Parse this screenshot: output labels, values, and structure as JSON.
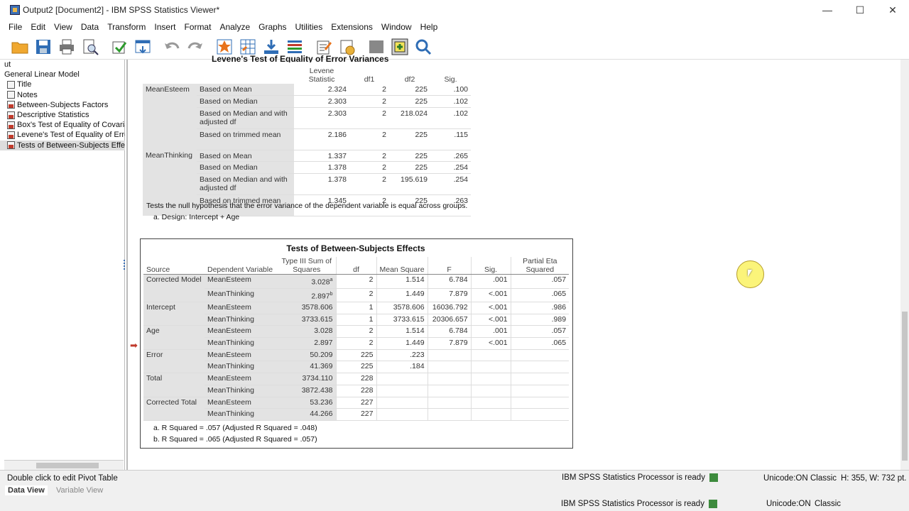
{
  "window": {
    "title": "Output2 [Document2] - IBM SPSS Statistics Viewer*",
    "minimize": "—",
    "maximize": "☐",
    "close": "✕"
  },
  "menu": [
    "File",
    "Edit",
    "View",
    "Data",
    "Transform",
    "Insert",
    "Format",
    "Analyze",
    "Graphs",
    "Utilities",
    "Extensions",
    "Window",
    "Help"
  ],
  "outline": {
    "root_prefix": "ut",
    "root": "General Linear Model",
    "items": [
      "Title",
      "Notes",
      "Between-Subjects Factors",
      "Descriptive Statistics",
      "Box's Test of Equality of Covariar",
      "Levene's Test of Equality of Error",
      "Tests of Between-Subjects Effec"
    ],
    "selected_index": 6
  },
  "levene": {
    "title": "Levene's Test of Equality of Error Variances",
    "headers": [
      "Levene Statistic",
      "df1",
      "df2",
      "Sig."
    ],
    "groups": [
      {
        "name": "MeanEsteem",
        "rows": [
          {
            "label": "Based on Mean",
            "stat": "2.324",
            "df1": "2",
            "df2": "225",
            "sig": ".100"
          },
          {
            "label": "Based on Median",
            "stat": "2.303",
            "df1": "2",
            "df2": "225",
            "sig": ".102"
          },
          {
            "label": "Based on Median and with adjusted df",
            "stat": "2.303",
            "df1": "2",
            "df2": "218.024",
            "sig": ".102"
          },
          {
            "label": "Based on trimmed mean",
            "stat": "2.186",
            "df1": "2",
            "df2": "225",
            "sig": ".115"
          }
        ]
      },
      {
        "name": "MeanThinking",
        "rows": [
          {
            "label": "Based on Mean",
            "stat": "1.337",
            "df1": "2",
            "df2": "225",
            "sig": ".265"
          },
          {
            "label": "Based on Median",
            "stat": "1.378",
            "df1": "2",
            "df2": "225",
            "sig": ".254"
          },
          {
            "label": "Based on Median and with adjusted df",
            "stat": "1.378",
            "df1": "2",
            "df2": "195.619",
            "sig": ".254"
          },
          {
            "label": "Based on trimmed mean",
            "stat": "1.345",
            "df1": "2",
            "df2": "225",
            "sig": ".263"
          }
        ]
      }
    ],
    "note1": "Tests the null hypothesis that the error variance of the dependent variable is equal across groups.",
    "note2": "a. Design: Intercept + Age"
  },
  "tbs": {
    "title": "Tests of Between-Subjects Effects",
    "headers": [
      "Source",
      "Dependent Variable",
      "Type III Sum of Squares",
      "df",
      "Mean Square",
      "F",
      "Sig.",
      "Partial Eta Squared"
    ],
    "rows": [
      {
        "src": "Corrected Model",
        "dv": "MeanEsteem",
        "ss": "3.028",
        "sup": "a",
        "df": "2",
        "ms": "1.514",
        "f": "6.784",
        "sig": ".001",
        "eta": ".057"
      },
      {
        "src": "",
        "dv": "MeanThinking",
        "ss": "2.897",
        "sup": "b",
        "df": "2",
        "ms": "1.449",
        "f": "7.879",
        "sig": "<.001",
        "eta": ".065"
      },
      {
        "src": "Intercept",
        "dv": "MeanEsteem",
        "ss": "3578.606",
        "sup": "",
        "df": "1",
        "ms": "3578.606",
        "f": "16036.792",
        "sig": "<.001",
        "eta": ".986"
      },
      {
        "src": "",
        "dv": "MeanThinking",
        "ss": "3733.615",
        "sup": "",
        "df": "1",
        "ms": "3733.615",
        "f": "20306.657",
        "sig": "<.001",
        "eta": ".989"
      },
      {
        "src": "Age",
        "dv": "MeanEsteem",
        "ss": "3.028",
        "sup": "",
        "df": "2",
        "ms": "1.514",
        "f": "6.784",
        "sig": ".001",
        "eta": ".057"
      },
      {
        "src": "",
        "dv": "MeanThinking",
        "ss": "2.897",
        "sup": "",
        "df": "2",
        "ms": "1.449",
        "f": "7.879",
        "sig": "<.001",
        "eta": ".065"
      },
      {
        "src": "Error",
        "dv": "MeanEsteem",
        "ss": "50.209",
        "sup": "",
        "df": "225",
        "ms": ".223",
        "f": "",
        "sig": "",
        "eta": ""
      },
      {
        "src": "",
        "dv": "MeanThinking",
        "ss": "41.369",
        "sup": "",
        "df": "225",
        "ms": ".184",
        "f": "",
        "sig": "",
        "eta": ""
      },
      {
        "src": "Total",
        "dv": "MeanEsteem",
        "ss": "3734.110",
        "sup": "",
        "df": "228",
        "ms": "",
        "f": "",
        "sig": "",
        "eta": ""
      },
      {
        "src": "",
        "dv": "MeanThinking",
        "ss": "3872.438",
        "sup": "",
        "df": "228",
        "ms": "",
        "f": "",
        "sig": "",
        "eta": ""
      },
      {
        "src": "Corrected Total",
        "dv": "MeanEsteem",
        "ss": "53.236",
        "sup": "",
        "df": "227",
        "ms": "",
        "f": "",
        "sig": "",
        "eta": ""
      },
      {
        "src": "",
        "dv": "MeanThinking",
        "ss": "44.266",
        "sup": "",
        "df": "227",
        "ms": "",
        "f": "",
        "sig": "",
        "eta": ""
      }
    ],
    "note_a": "a. R Squared = .057 (Adjusted R Squared = .048)",
    "note_b": "b. R Squared = .065 (Adjusted R Squared = .057)"
  },
  "status": {
    "hint": "Double click to edit Pivot Table",
    "processor": "IBM SPSS Statistics Processor is ready",
    "unicode": "Unicode:ON",
    "mode": "Classic",
    "size": "H: 355, W: 732 pt."
  },
  "bottom": {
    "tab_data": "Data View",
    "tab_variable": "Variable View",
    "processor": "IBM SPSS Statistics Processor is ready",
    "unicode": "Unicode:ON",
    "mode": "Classic"
  },
  "colors": {
    "accent": "#3b6fb6",
    "highlight": "#fbf47a",
    "arrow": "#c0392b"
  }
}
